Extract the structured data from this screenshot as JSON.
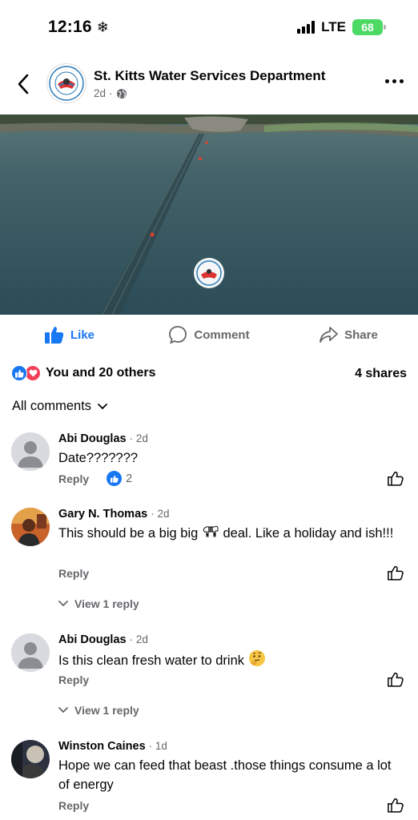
{
  "status": {
    "time": "12:16",
    "network": "LTE",
    "battery": "68"
  },
  "post": {
    "page_name": "St. Kitts Water Services Department",
    "age": "2d",
    "meta_separator": "·"
  },
  "actions": {
    "like": "Like",
    "comment": "Comment",
    "share": "Share"
  },
  "summary": {
    "reactions": "You and 20 others",
    "shares": "4 shares"
  },
  "comments_filter": "All comments",
  "comments": [
    {
      "name": "Abi Douglas",
      "time": "· 2d",
      "text": "Date???????",
      "reply": "Reply",
      "likes": "2"
    },
    {
      "name": "Gary N. Thomas",
      "time": "· 2d",
      "text_before": "This should be a big big",
      "text_after": "deal. Like a holiday and ish!!!",
      "reply": "Reply",
      "view_reply": "View 1 reply"
    },
    {
      "name": "Abi Douglas",
      "time": "· 2d",
      "text": "Is this clean fresh water to drink",
      "reply": "Reply",
      "view_reply": "View 1 reply"
    },
    {
      "name": "Winston Caines",
      "time": "· 1d",
      "text": "Hope we can feed that beast .those things consume a lot of energy",
      "reply": "Reply"
    }
  ],
  "colors": {
    "brand_blue": "#1877f2",
    "love_red": "#f33e58",
    "secondary_text": "#65676b",
    "battery_green": "#4cd964"
  },
  "icons": [
    "snowflake-icon",
    "signal-icon",
    "battery-icon",
    "back-icon",
    "globe-icon",
    "more-icon",
    "like-icon",
    "comment-icon",
    "share-icon",
    "chevron-down-icon",
    "zebra-emoji-icon",
    "thinking-emoji-icon"
  ]
}
